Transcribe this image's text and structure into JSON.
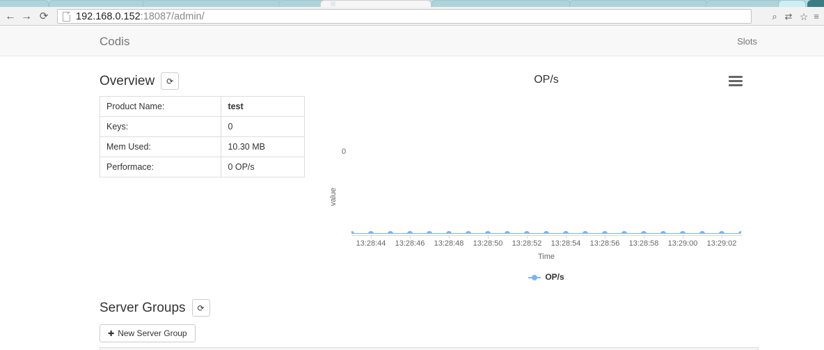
{
  "browser": {
    "back_icon": "←",
    "forward_icon": "→",
    "reload_icon": "⟳",
    "url_host": "192.168.0.152",
    "url_rest": ":18087/admin/",
    "search_icon": "⌕",
    "translate_icon": "⇄",
    "star_icon": "☆",
    "menu_icon": "≡"
  },
  "navbar": {
    "brand": "Codis",
    "slots_link": "Slots"
  },
  "overview": {
    "title": "Overview",
    "refresh_icon": "⟳",
    "rows": [
      {
        "key": "Product Name:",
        "value": "test",
        "bold": true
      },
      {
        "key": "Keys:",
        "value": "0",
        "bold": false
      },
      {
        "key": "Mem Used:",
        "value": "10.30 MB",
        "bold": false
      },
      {
        "key": "Performace:",
        "value": "0 OP/s",
        "bold": false
      }
    ]
  },
  "chart_data": {
    "type": "line",
    "title": "OP/s",
    "xlabel": "Time",
    "ylabel": "value",
    "grid": false,
    "legend_position": "bottom",
    "series": [
      {
        "name": "OP/s",
        "color": "#7cb5ec",
        "values": [
          0,
          0,
          0,
          0,
          0,
          0,
          0,
          0,
          0,
          0,
          0,
          0,
          0,
          0,
          0,
          0,
          0,
          0,
          0,
          0,
          0
        ]
      }
    ],
    "x": [
      "13:28:43",
      "13:28:44",
      "13:28:45",
      "13:28:46",
      "13:28:47",
      "13:28:48",
      "13:28:49",
      "13:28:50",
      "13:28:51",
      "13:28:52",
      "13:28:53",
      "13:28:54",
      "13:28:55",
      "13:28:56",
      "13:28:57",
      "13:28:58",
      "13:28:59",
      "13:29:00",
      "13:29:01",
      "13:29:02",
      "13:29:03"
    ],
    "xtick_labels": [
      "13:28:44",
      "13:28:46",
      "13:28:48",
      "13:28:50",
      "13:28:52",
      "13:28:54",
      "13:28:56",
      "13:28:58",
      "13:29:00",
      "13:29:02"
    ],
    "ytick_labels": [
      "0"
    ],
    "ylim": [
      0,
      1
    ],
    "menu_icon": "hamburger"
  },
  "server_groups": {
    "title": "Server Groups",
    "refresh_icon": "⟳",
    "new_group_label": "New Server Group",
    "plus_icon": "✚"
  }
}
